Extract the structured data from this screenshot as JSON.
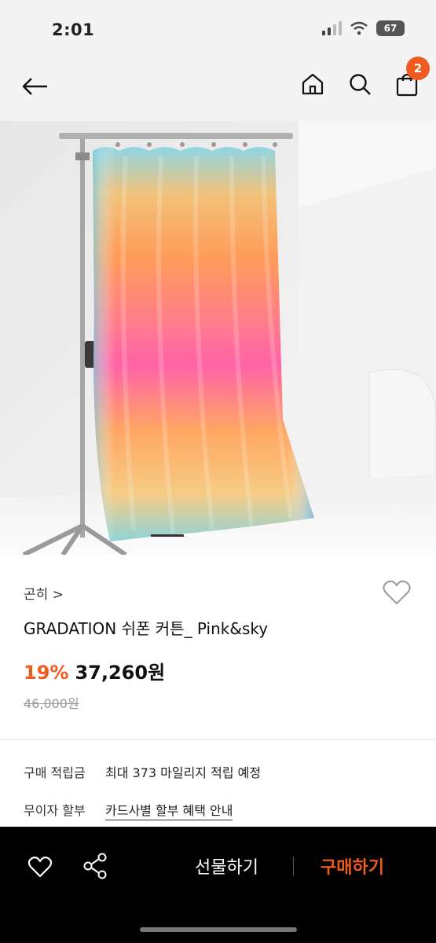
{
  "status_bar": {
    "time": "2:01",
    "battery": "67"
  },
  "nav": {
    "cart_count": "2"
  },
  "product": {
    "brand": "곤히 >",
    "title": "GRADATION 쉬폰 커튼_ Pink&sky",
    "discount": "19%",
    "price": "37,260원",
    "original_price": "46,000원",
    "image_count_position": 1
  },
  "benefits": {
    "points_label": "구매 적립금",
    "points_value": "최대 373 마일리지 적립 예정",
    "installment_label": "무이자 할부",
    "installment_link": "카드사별 할부 혜택 안내"
  },
  "bottom_bar": {
    "gift_label": "선물하기",
    "buy_label": "구매하기"
  },
  "colors": {
    "accent": "#ef5a1e",
    "bottom_bar_bg": "#000000"
  }
}
